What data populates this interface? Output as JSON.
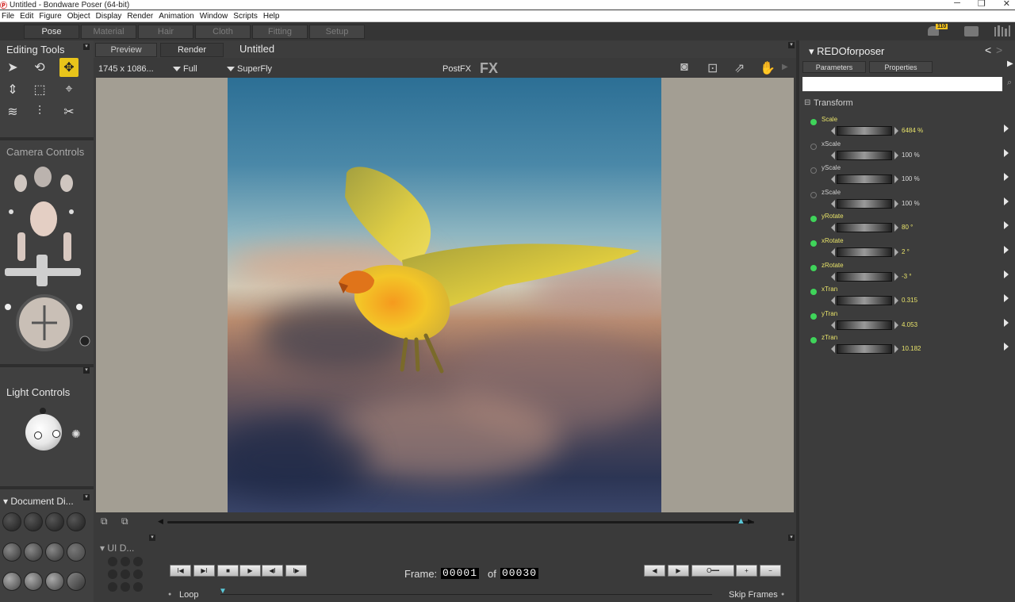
{
  "window": {
    "title": "Untitled - Bondware Poser (64-bit)"
  },
  "menu": [
    "File",
    "Edit",
    "Figure",
    "Object",
    "Display",
    "Render",
    "Animation",
    "Window",
    "Scripts",
    "Help"
  ],
  "rooms": [
    "Pose",
    "Material",
    "Hair",
    "Cloth",
    "Fitting",
    "Setup"
  ],
  "notifications": {
    "count": "110"
  },
  "left": {
    "editing_tools": "Editing Tools",
    "camera_controls": "Camera Controls",
    "light_controls": "Light Controls",
    "document_display": "Document Di...",
    "ui_dots": "UI D..."
  },
  "view": {
    "tabs": [
      "Preview",
      "Render"
    ],
    "document_title": "Untitled",
    "resolution": "1745 x 1086...",
    "size_mode": "Full",
    "renderer": "SuperFly",
    "postfx": "PostFX",
    "fx": "FX"
  },
  "playback": {
    "frame_label": "Frame:",
    "current_frame": "00001",
    "of_label": "of",
    "total_frames": "00030",
    "loop": "Loop",
    "skip_frames": "Skip Frames"
  },
  "right": {
    "title": "REDOforposer",
    "tabs": [
      "Parameters",
      "Properties"
    ],
    "group": "Transform",
    "params": [
      {
        "name": "Scale",
        "value": "6484 %",
        "on": true
      },
      {
        "name": "xScale",
        "value": "100 %",
        "on": false
      },
      {
        "name": "yScale",
        "value": "100 %",
        "on": false
      },
      {
        "name": "zScale",
        "value": "100 %",
        "on": false
      },
      {
        "name": "yRotate",
        "value": "80 °",
        "on": true
      },
      {
        "name": "xRotate",
        "value": "2 °",
        "on": true
      },
      {
        "name": "zRotate",
        "value": "-3 °",
        "on": true
      },
      {
        "name": "xTran",
        "value": "0.315",
        "on": true
      },
      {
        "name": "yTran",
        "value": "4.053",
        "on": true
      },
      {
        "name": "zTran",
        "value": "10.182",
        "on": true
      }
    ]
  },
  "colors": {
    "accent": "#e8c41a",
    "param_on": "#3fd45a",
    "param_value": "#e8e36a"
  }
}
